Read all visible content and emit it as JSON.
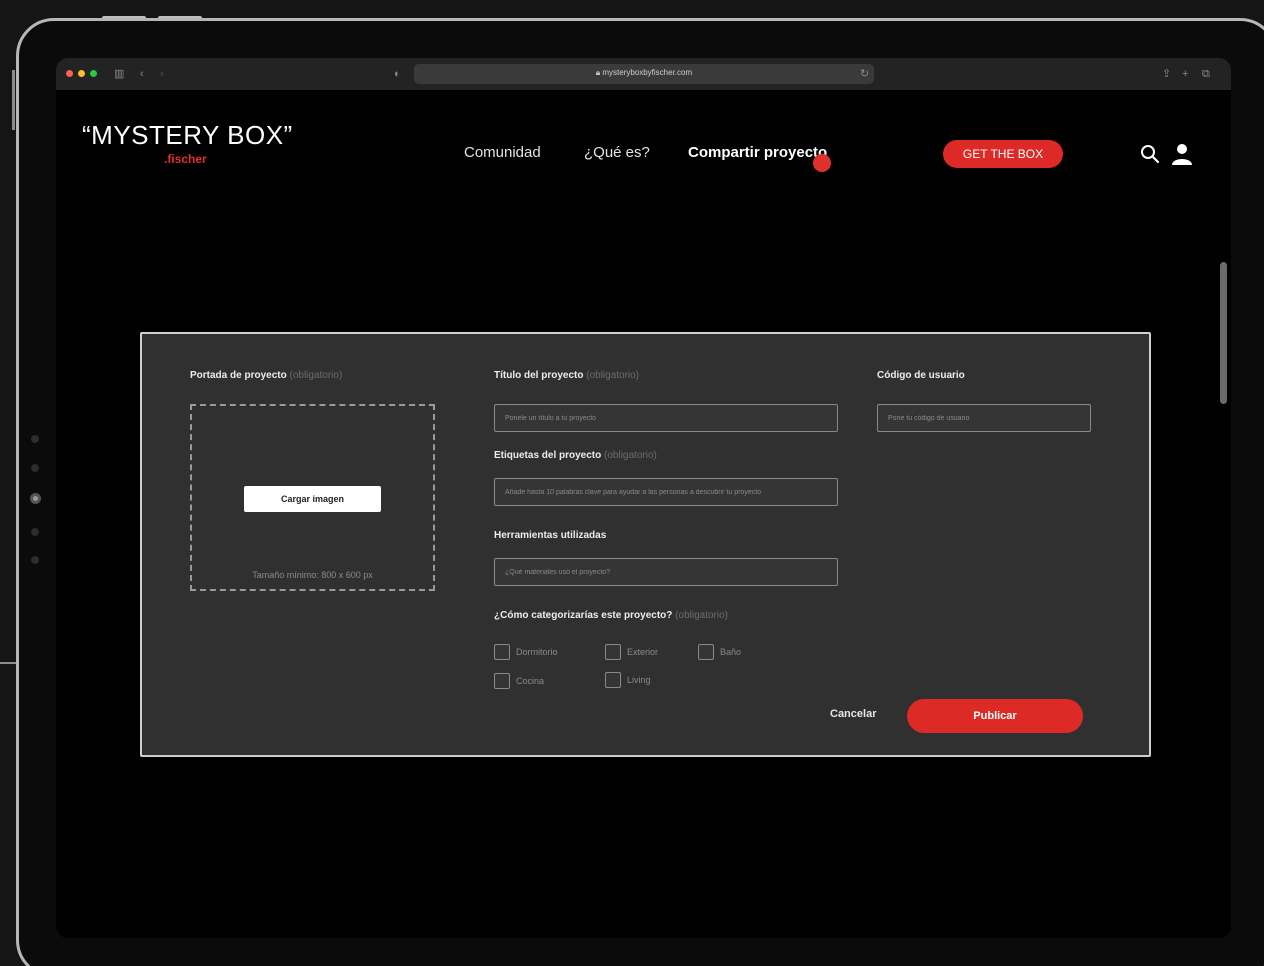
{
  "browser": {
    "url": "mysteryboxbyfischer.com",
    "traffic_light_colors": [
      "#ff5f57",
      "#febc2e",
      "#28c840"
    ]
  },
  "header": {
    "logo_title": "“MYSTERY BOX”",
    "logo_subtitle": ".fischer",
    "nav": [
      {
        "label": "Comunidad",
        "active": false
      },
      {
        "label": "¿Qué es?",
        "active": false
      },
      {
        "label": "Compartir proyecto",
        "active": true
      }
    ],
    "cta_label": "GET THE BOX",
    "icons": [
      "search-icon",
      "user-icon"
    ]
  },
  "form": {
    "cover": {
      "label": "Portada de proyecto",
      "required": "(obligatorio)",
      "button": "Cargar imagen",
      "note": "Tamaño mínimo: 800 x 600 px"
    },
    "title": {
      "label": "Título del proyecto",
      "required": "(obligatorio)",
      "placeholder": "Ponele un título a tu proyecto"
    },
    "user_code": {
      "label": "Código de usuario",
      "placeholder": "Pone tu código de usuario"
    },
    "tags": {
      "label": "Etiquetas del proyecto",
      "required": "(obligatorio)",
      "placeholder": "Añade hasta 10 palabras clave para ayudar a las personas a descubrir tu proyecto"
    },
    "tools": {
      "label": "Herramientas utilizadas",
      "placeholder": "¿Qué materiales usó el proyecto?"
    },
    "categories": {
      "label": "¿Cómo categorizarías este proyecto?",
      "required": "(obligatorio)",
      "options": [
        "Dormitorio",
        "Exterior",
        "Baño",
        "Cocina",
        "Living"
      ]
    },
    "cancel_label": "Cancelar",
    "publish_label": "Publicar"
  },
  "colors": {
    "accent": "#dd2a27",
    "panel": "#303030",
    "background": "#000000"
  }
}
